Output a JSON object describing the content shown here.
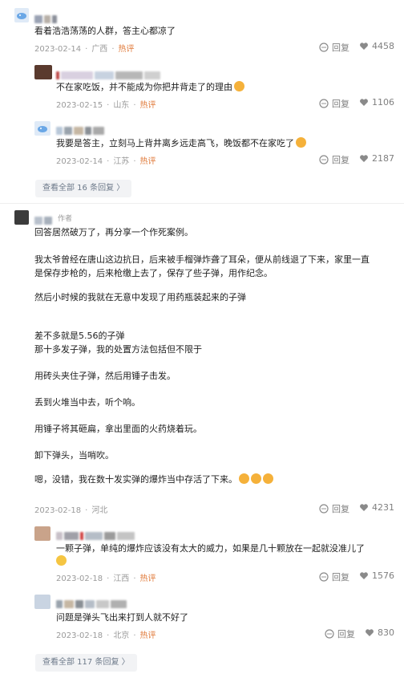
{
  "colors": {
    "hot": "#e07a3a",
    "meta": "#9a9a9a",
    "action": "#7f7f7f",
    "more_bg": "#f2f3f5",
    "more_text": "#6d7a8a"
  },
  "comment1": {
    "text": "看着浩浩荡荡的人群，答主心都凉了",
    "date": "2023-02-14",
    "location": "广西",
    "hot": "热评",
    "reply": "回复",
    "likes": "4458"
  },
  "reply1": {
    "text": "不在家吃饭，并不能成为你把井背走了的理由",
    "date": "2023-02-15",
    "location": "山东",
    "hot": "热评",
    "reply": "回复",
    "likes": "1106"
  },
  "reply2": {
    "text": "我要是答主，立刻马上背井离乡远走高飞，晚饭都不在家吃了",
    "date": "2023-02-14",
    "location": "江苏",
    "hot": "热评",
    "reply": "回复",
    "likes": "2187"
  },
  "more1": {
    "label": "查看全部 16 条回复 〉"
  },
  "comment2": {
    "author_tag": "作者",
    "lines": [
      "回答居然破万了，再分享一个作死案例。",
      "我太爷曾经在唐山这边抗日，后来被手榴弹炸聋了耳朵，便从前线退了下来，家里一直",
      "是保存步枪的，后来枪缴上去了，保存了些子弹，用作纪念。",
      "然后小时候的我就在无意中发现了用药瓶装起来的子弹",
      "差不多就是5.56的子弹",
      "那十多发子弹，我的处置方法包括但不限于",
      "用砖头夹住子弹，然后用锤子击发。",
      "丢到火堆当中去，听个响。",
      "用锤子将其砸扁，拿出里面的火药烧着玩。",
      "卸下弹头，当哨吹。",
      "嗯，没错，我在数十发实弹的爆炸当中存活了下来。"
    ],
    "date": "2023-02-18",
    "location": "河北",
    "reply": "回复",
    "likes": "4231"
  },
  "reply3": {
    "line1": "一颗子弹，单纯的爆炸应该没有太大的威力，如果是几十颗放在一起就没准儿了",
    "date": "2023-02-18",
    "location": "江西",
    "hot": "热评",
    "reply": "回复",
    "likes": "1576"
  },
  "reply4": {
    "text": "问题是弹头飞出来打到人就不好了",
    "date": "2023-02-18",
    "location": "北京",
    "hot": "热评",
    "reply": "回复",
    "likes": "830"
  },
  "more2": {
    "label": "查看全部 117 条回复 〉"
  }
}
